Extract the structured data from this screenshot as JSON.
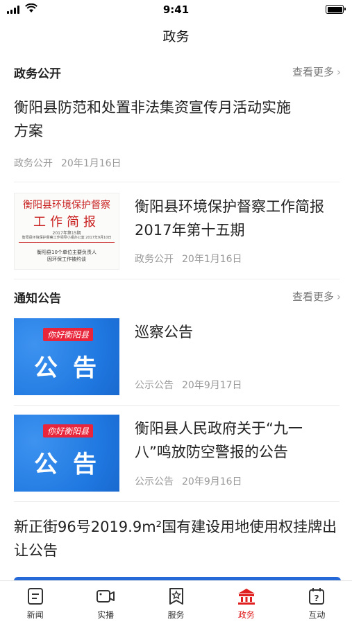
{
  "status_bar": {
    "time": "9:41"
  },
  "nav": {
    "title": "政务"
  },
  "sections": [
    {
      "title": "政务公开",
      "more": "查看更多"
    },
    {
      "title": "通知公告",
      "more": "查看更多"
    }
  ],
  "articles": [
    {
      "title": "衡阳县防范和处置非法集资宣传月活动实施方案",
      "category": "政务公开",
      "date": "20年1月16日"
    },
    {
      "title": "衡阳县环境保护督察工作简报2017年第十五期",
      "category": "政务公开",
      "date": "20年1月16日",
      "thumb": {
        "line1": "衡阳县环境保护督察",
        "line2": "工作简报",
        "line3": "2017年第15期",
        "line4": "衡阳县环境保护督察工作领导小组办公室   2017年9月10日",
        "line5a": "衡阳县10个单位主要负责人",
        "line5b": "因环保工作被约谈"
      }
    },
    {
      "title": "巡察公告",
      "category": "公示公告",
      "date": "20年9月17日",
      "thumb": {
        "tag": "你好衡阳县",
        "text": "公告"
      }
    },
    {
      "title": "衡阳县人民政府关于“九一八”鸣放防空警报的公告",
      "category": "公示公告",
      "date": "20年9月16日",
      "thumb": {
        "tag": "你好衡阳县",
        "text": "公告"
      }
    },
    {
      "title": "新正街96号2019.9m²国有建设用地使用权挂牌出让公告"
    }
  ],
  "tabbar": [
    {
      "label": "新闻",
      "icon": "news-icon",
      "active": false
    },
    {
      "label": "实播",
      "icon": "video-icon",
      "active": false
    },
    {
      "label": "服务",
      "icon": "service-icon",
      "active": false
    },
    {
      "label": "政务",
      "icon": "government-icon",
      "active": true
    },
    {
      "label": "互动",
      "icon": "interaction-icon",
      "active": false
    }
  ],
  "colors": {
    "accent": "#e02020",
    "notice_blue": "#1f78e0",
    "meta_gray": "#999999"
  }
}
